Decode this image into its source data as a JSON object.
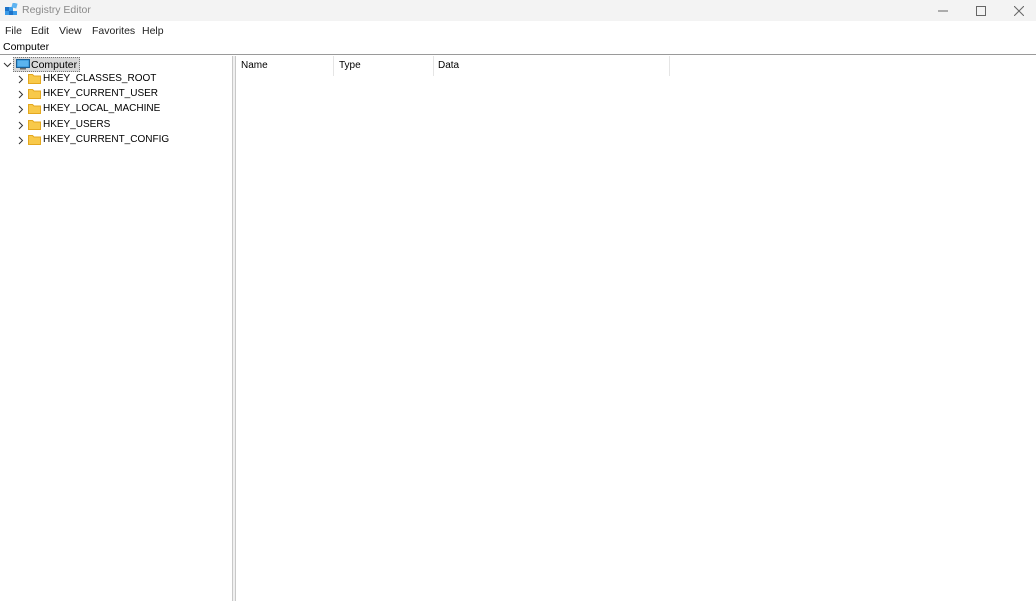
{
  "window": {
    "title": "Registry Editor"
  },
  "menu": [
    {
      "label": "File"
    },
    {
      "label": "Edit"
    },
    {
      "label": "View"
    },
    {
      "label": "Favorites"
    },
    {
      "label": "Help"
    }
  ],
  "address": {
    "path": "Computer"
  },
  "tree": {
    "root": {
      "label": "Computer",
      "icon": "computer-icon",
      "expanded": true,
      "selected": true
    },
    "children": [
      {
        "label": "HKEY_CLASSES_ROOT",
        "icon": "folder-icon"
      },
      {
        "label": "HKEY_CURRENT_USER",
        "icon": "folder-icon"
      },
      {
        "label": "HKEY_LOCAL_MACHINE",
        "icon": "folder-icon"
      },
      {
        "label": "HKEY_USERS",
        "icon": "folder-icon"
      },
      {
        "label": "HKEY_CURRENT_CONFIG",
        "icon": "folder-icon"
      }
    ]
  },
  "list": {
    "columns": [
      {
        "label": "Name"
      },
      {
        "label": "Type"
      },
      {
        "label": "Data"
      }
    ],
    "rows": []
  },
  "colors": {
    "folder": "#f8c94a",
    "folder_dark": "#e4a81f",
    "monitor": "#2d8fd5",
    "selection": "#d9d9d9"
  }
}
